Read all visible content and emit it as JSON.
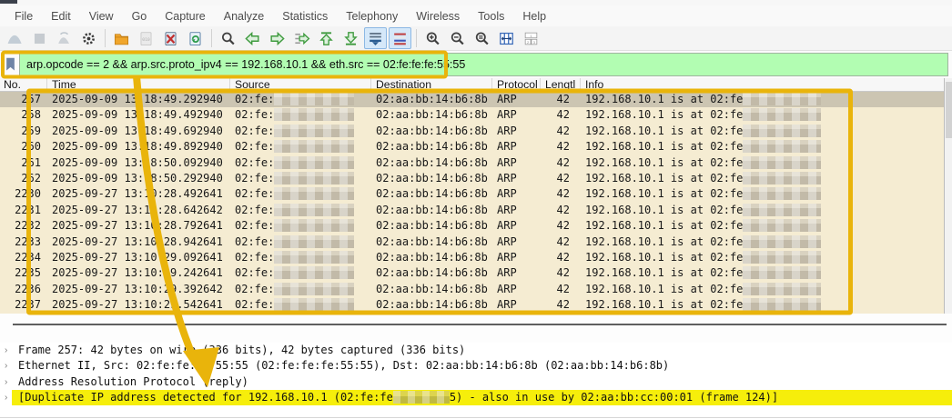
{
  "menu": {
    "items": [
      "File",
      "Edit",
      "View",
      "Go",
      "Capture",
      "Analyze",
      "Statistics",
      "Telephony",
      "Wireless",
      "Tools",
      "Help"
    ]
  },
  "toolbar": {
    "icons": [
      {
        "name": "start-capture-icon",
        "kind": "fin",
        "state": "disabled"
      },
      {
        "name": "stop-capture-icon",
        "kind": "stop",
        "state": "disabled"
      },
      {
        "name": "restart-capture-icon",
        "kind": "restart",
        "state": "disabled"
      },
      {
        "name": "capture-options-icon",
        "kind": "gear",
        "state": "normal"
      },
      {
        "name": "sep",
        "kind": "sep"
      },
      {
        "name": "open-file-icon",
        "kind": "folder",
        "state": "normal"
      },
      {
        "name": "save-file-icon",
        "kind": "save010",
        "state": "disabled"
      },
      {
        "name": "close-file-icon",
        "kind": "closex",
        "state": "normal"
      },
      {
        "name": "reload-file-icon",
        "kind": "reload",
        "state": "normal"
      },
      {
        "name": "sep",
        "kind": "sep"
      },
      {
        "name": "find-packet-icon",
        "kind": "find",
        "state": "normal"
      },
      {
        "name": "go-back-icon",
        "kind": "arrl",
        "state": "normal"
      },
      {
        "name": "go-forward-icon",
        "kind": "arrr",
        "state": "normal"
      },
      {
        "name": "go-to-packet-icon",
        "kind": "goto",
        "state": "normal"
      },
      {
        "name": "go-to-top-icon",
        "kind": "arru",
        "state": "normal"
      },
      {
        "name": "go-to-bottom-icon",
        "kind": "arrd",
        "state": "normal"
      },
      {
        "name": "auto-scroll-icon",
        "kind": "autoscroll",
        "state": "selected"
      },
      {
        "name": "colorize-icon",
        "kind": "colorize",
        "state": "selected"
      },
      {
        "name": "sep",
        "kind": "sep"
      },
      {
        "name": "zoom-in-icon",
        "kind": "zin",
        "state": "normal"
      },
      {
        "name": "zoom-out-icon",
        "kind": "zout",
        "state": "normal"
      },
      {
        "name": "zoom-reset-icon",
        "kind": "zreset",
        "state": "normal"
      },
      {
        "name": "resize-columns-icon",
        "kind": "cols",
        "state": "normal"
      },
      {
        "name": "layout-123-icon",
        "kind": "layout",
        "state": "normal"
      }
    ]
  },
  "filter": {
    "value": "arp.opcode == 2 && arp.src.proto_ipv4 == 192.168.10.1 && eth.src == 02:fe:fe:fe:55:55",
    "bookmark_icon": "filter-bookmark-icon"
  },
  "packet_table": {
    "columns": [
      "No.",
      "Time",
      "Source",
      "Destination",
      "Protocol",
      "Lengtl",
      "Info"
    ],
    "source_redacted": true,
    "info_redacted": true,
    "rows": [
      {
        "no": "257",
        "time": "2025-09-09 13:18:49.292940",
        "source": "02:fe:",
        "destination": "02:aa:bb:14:b6:8b",
        "protocol": "ARP",
        "length": "42",
        "info": "192.168.10.1 is at 02:fe",
        "selected": true
      },
      {
        "no": "258",
        "time": "2025-09-09 13:18:49.492940",
        "source": "02:fe:",
        "destination": "02:aa:bb:14:b6:8b",
        "protocol": "ARP",
        "length": "42",
        "info": "192.168.10.1 is at 02:fe",
        "selected": false
      },
      {
        "no": "259",
        "time": "2025-09-09 13:18:49.692940",
        "source": "02:fe:",
        "destination": "02:aa:bb:14:b6:8b",
        "protocol": "ARP",
        "length": "42",
        "info": "192.168.10.1 is at 02:fe",
        "selected": false
      },
      {
        "no": "260",
        "time": "2025-09-09 13:18:49.892940",
        "source": "02:fe:",
        "destination": "02:aa:bb:14:b6:8b",
        "protocol": "ARP",
        "length": "42",
        "info": "192.168.10.1 is at 02:fe",
        "selected": false
      },
      {
        "no": "261",
        "time": "2025-09-09 13:18:50.092940",
        "source": "02:fe:",
        "destination": "02:aa:bb:14:b6:8b",
        "protocol": "ARP",
        "length": "42",
        "info": "192.168.10.1 is at 02:fe",
        "selected": false
      },
      {
        "no": "262",
        "time": "2025-09-09 13:18:50.292940",
        "source": "02:fe:",
        "destination": "02:aa:bb:14:b6:8b",
        "protocol": "ARP",
        "length": "42",
        "info": "192.168.10.1 is at 02:fe",
        "selected": false
      },
      {
        "no": "2230",
        "time": "2025-09-27 13:10:28.492641",
        "source": "02:fe:",
        "destination": "02:aa:bb:14:b6:8b",
        "protocol": "ARP",
        "length": "42",
        "info": "192.168.10.1 is at 02:fe",
        "selected": false
      },
      {
        "no": "2231",
        "time": "2025-09-27 13:10:28.642642",
        "source": "02:fe:",
        "destination": "02:aa:bb:14:b6:8b",
        "protocol": "ARP",
        "length": "42",
        "info": "192.168.10.1 is at 02:fe",
        "selected": false
      },
      {
        "no": "2232",
        "time": "2025-09-27 13:10:28.792641",
        "source": "02:fe:",
        "destination": "02:aa:bb:14:b6:8b",
        "protocol": "ARP",
        "length": "42",
        "info": "192.168.10.1 is at 02:fe",
        "selected": false
      },
      {
        "no": "2233",
        "time": "2025-09-27 13:10:28.942641",
        "source": "02:fe:",
        "destination": "02:aa:bb:14:b6:8b",
        "protocol": "ARP",
        "length": "42",
        "info": "192.168.10.1 is at 02:fe",
        "selected": false
      },
      {
        "no": "2234",
        "time": "2025-09-27 13:10:29.092641",
        "source": "02:fe:",
        "destination": "02:aa:bb:14:b6:8b",
        "protocol": "ARP",
        "length": "42",
        "info": "192.168.10.1 is at 02:fe",
        "selected": false
      },
      {
        "no": "2235",
        "time": "2025-09-27 13:10:29.242641",
        "source": "02:fe:",
        "destination": "02:aa:bb:14:b6:8b",
        "protocol": "ARP",
        "length": "42",
        "info": "192.168.10.1 is at 02:fe",
        "selected": false
      },
      {
        "no": "2236",
        "time": "2025-09-27 13:10:29.392642",
        "source": "02:fe:",
        "destination": "02:aa:bb:14:b6:8b",
        "protocol": "ARP",
        "length": "42",
        "info": "192.168.10.1 is at 02:fe",
        "selected": false
      },
      {
        "no": "2237",
        "time": "2025-09-27 13:10:29.542641",
        "source": "02:fe:",
        "destination": "02:aa:bb:14:b6:8b",
        "protocol": "ARP",
        "length": "42",
        "info": "192.168.10.1 is at 02:fe",
        "selected": false
      }
    ]
  },
  "details": {
    "lines": [
      {
        "text": "Frame 257: 42 bytes on wire (336 bits), 42 bytes captured (336 bits)",
        "highlight": false,
        "redacted": false
      },
      {
        "text": "Ethernet II, Src: 02:fe:fe:fe:55:55 (02:fe:fe:fe:55:55), Dst: 02:aa:bb:14:b6:8b (02:aa:bb:14:b6:8b)",
        "highlight": false,
        "redacted": false
      },
      {
        "text": "Address Resolution Protocol (reply)",
        "highlight": false,
        "redacted": false
      },
      {
        "prefix": "[Duplicate IP address detected for 192.168.10.1 (02:fe:fe",
        "suffix": "5) - also in use by 02:aa:bb:cc:00:01 (frame 124)]",
        "highlight": true,
        "redacted": true
      }
    ]
  },
  "annotations": {
    "highlight_color": "#e9b40b",
    "boxed_regions": [
      "display-filter-bar",
      "packet-list"
    ],
    "arrow_target": "duplicate-ip-warning-line"
  },
  "colors": {
    "filter_valid_bg": "#b2fdb2",
    "arp_row_bg": "#f5ecd2",
    "selected_row_bg": "#ccc5b2",
    "warning_bg": "#f6ee0b",
    "annotation": "#e9b40b"
  }
}
